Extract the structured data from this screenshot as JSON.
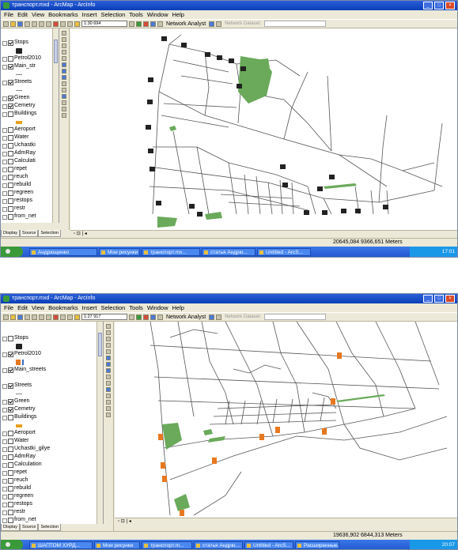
{
  "screens": [
    {
      "title": "транспорт.mxd - ArcMap - ArcInfo",
      "menu": [
        "File",
        "Edit",
        "View",
        "Bookmarks",
        "Insert",
        "Selection",
        "Tools",
        "Window",
        "Help"
      ],
      "scale": "1:30 694",
      "network_analyst": "Network Analyst",
      "network_dataset": "Network Dataset:",
      "toc_layers": [
        {
          "label": "Stops",
          "checked": true,
          "symbol": "bus"
        },
        {
          "label": "Petrol2010",
          "checked": false,
          "symbol": "none"
        },
        {
          "label": "Main_str",
          "checked": true,
          "symbol": "none"
        },
        {
          "label": "Streets",
          "checked": true,
          "symbol": "none"
        },
        {
          "label": "Green",
          "checked": true,
          "symbol": "none"
        },
        {
          "label": "Cemetry",
          "checked": true,
          "symbol": "none"
        },
        {
          "label": "Buildings",
          "checked": false,
          "symbol": "fill"
        },
        {
          "label": "Aeroport",
          "checked": false,
          "symbol": "none"
        },
        {
          "label": "Water",
          "checked": false,
          "symbol": "none"
        },
        {
          "label": "Uchastki",
          "checked": false,
          "symbol": "none"
        },
        {
          "label": "AdmRay",
          "checked": false,
          "symbol": "none"
        },
        {
          "label": "Calculati",
          "checked": false,
          "symbol": "none"
        },
        {
          "label": "repet",
          "checked": false,
          "symbol": "none"
        },
        {
          "label": "reuch",
          "checked": false,
          "symbol": "none"
        },
        {
          "label": "rebuild",
          "checked": false,
          "symbol": "none"
        },
        {
          "label": "regreen",
          "checked": false,
          "symbol": "none"
        },
        {
          "label": "restops",
          "checked": false,
          "symbol": "none"
        },
        {
          "label": "restr",
          "checked": false,
          "symbol": "none"
        },
        {
          "label": "from_net",
          "checked": false,
          "symbol": "none"
        }
      ],
      "toc_tabs": [
        "Display",
        "Source",
        "Selection"
      ],
      "coords": "20645,084  9366,651 Meters",
      "taskbar": [
        "Андрющенко",
        "Мои рисунки",
        "транспорт.mx...",
        "статья Андрю...",
        "Untitled - ArcS..."
      ],
      "clock": "17:01"
    },
    {
      "title": "транспорт.mxd - ArcMap - ArcInfo",
      "menu": [
        "File",
        "Edit",
        "View",
        "Bookmarks",
        "Insert",
        "Selection",
        "Tools",
        "Window",
        "Help"
      ],
      "scale": "1:27 917",
      "network_analyst": "Network Analyst",
      "network_dataset": "Network Dataset:",
      "toc_layers": [
        {
          "label": "Stops",
          "checked": false,
          "symbol": "bus"
        },
        {
          "label": "Petrol2010",
          "checked": true,
          "symbol": "fuel"
        },
        {
          "label": "Main_streets",
          "checked": true,
          "symbol": "none"
        },
        {
          "label": "Streets",
          "checked": true,
          "symbol": "line"
        },
        {
          "label": "Green",
          "checked": true,
          "symbol": "none"
        },
        {
          "label": "Cemetry",
          "checked": true,
          "symbol": "none"
        },
        {
          "label": "Buildings",
          "checked": false,
          "symbol": "fill"
        },
        {
          "label": "Aeroport",
          "checked": false,
          "symbol": "none"
        },
        {
          "label": "Water",
          "checked": false,
          "symbol": "none"
        },
        {
          "label": "Uchastki_gilye",
          "checked": false,
          "symbol": "none"
        },
        {
          "label": "AdmRay",
          "checked": false,
          "symbol": "none"
        },
        {
          "label": "Calculation",
          "checked": false,
          "symbol": "none"
        },
        {
          "label": "repet",
          "checked": false,
          "symbol": "none"
        },
        {
          "label": "reuch",
          "checked": false,
          "symbol": "none"
        },
        {
          "label": "rebuild",
          "checked": false,
          "symbol": "none"
        },
        {
          "label": "regreen",
          "checked": false,
          "symbol": "none"
        },
        {
          "label": "restops",
          "checked": false,
          "symbol": "none"
        },
        {
          "label": "restr",
          "checked": false,
          "symbol": "none"
        },
        {
          "label": "from_net",
          "checked": false,
          "symbol": "none"
        }
      ],
      "toc_tabs": [
        "Display",
        "Source",
        "Selection"
      ],
      "coords": "19636,902  6844,313 Meters",
      "taskbar": [
        "ШАПТОМ ХУРД...",
        "Мои рисунки",
        "транспорт.m...",
        "статья Андрю...",
        "Untitled - ArcS...",
        "Расширенные..."
      ],
      "clock": "20:07"
    }
  ]
}
